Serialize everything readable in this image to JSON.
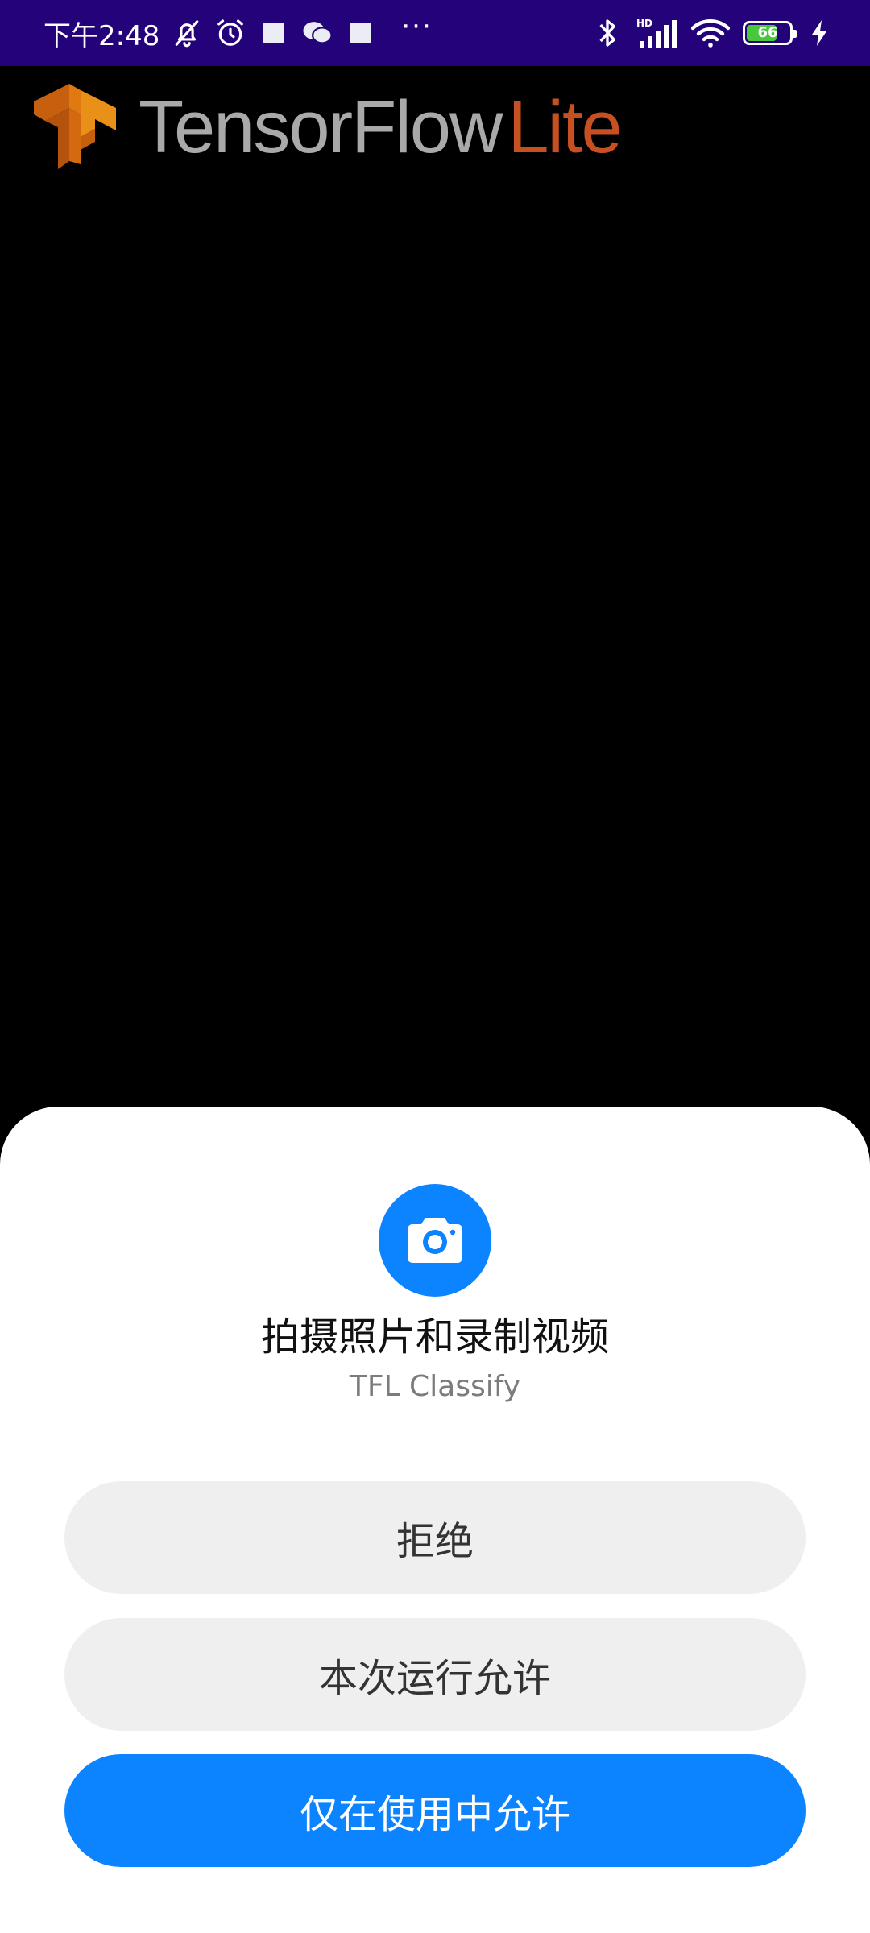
{
  "status_bar": {
    "time": "下午2:48",
    "left_icons": [
      "muted-bell-icon",
      "alarm-clock-icon",
      "notification-square-icon",
      "wechat-icon",
      "notification-square-icon"
    ],
    "more": "···",
    "right_icons": [
      "bluetooth-icon",
      "hd-signal-icon",
      "wifi-icon",
      "battery-icon",
      "charging-icon"
    ],
    "signal_badge": "HD",
    "battery_level": "66",
    "colors": {
      "background": "#24037a",
      "battery_fill": "#48c83c"
    }
  },
  "header": {
    "brand_main": "TensorFlow",
    "brand_accent": "Lite",
    "colors": {
      "logo": "#e07a10",
      "main": "#a9a9a9",
      "accent": "#c65022"
    }
  },
  "dialog": {
    "icon": "camera-icon",
    "title": "拍摄照片和录制视频",
    "subtitle": "TFL Classify",
    "buttons": {
      "deny": "拒绝",
      "allow_once": "本次运行允许",
      "allow_while_using": "仅在使用中允许"
    },
    "colors": {
      "primary": "#0d84ff",
      "secondary_button": "#efefef"
    }
  }
}
